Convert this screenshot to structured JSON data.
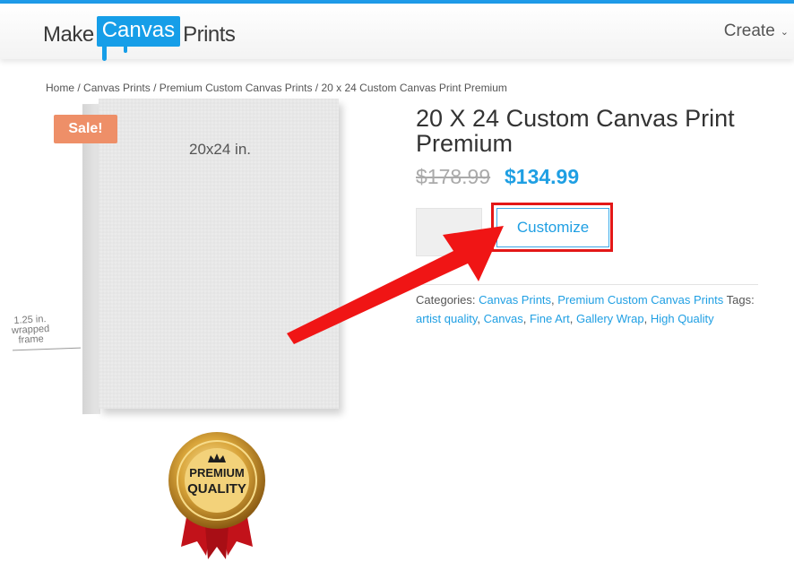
{
  "header": {
    "logo": {
      "make": "Make",
      "canvas": "Canvas",
      "prints": "Prints"
    },
    "menu_create": "Create"
  },
  "breadcrumb": [
    {
      "label": "Home"
    },
    {
      "label": "Canvas Prints"
    },
    {
      "label": "Premium Custom Canvas Prints"
    },
    {
      "label": "20 x 24 Custom Canvas Print Premium"
    }
  ],
  "breadcrumb_sep": " / ",
  "product": {
    "sale_badge": "Sale!",
    "canvas_size_label": "20x24 in.",
    "wrap_label": [
      "1.25 in.",
      "wrapped",
      "frame"
    ],
    "seal": {
      "line1": "PREMIUM",
      "line2": "QUALITY"
    },
    "title": "20 X 24 Custom Canvas Print Premium",
    "price_old": "$178.99",
    "price_new": "$134.99",
    "customize_label": "Customize",
    "categories_label": "Categories:",
    "categories": [
      "Canvas Prints",
      "Premium Custom Canvas Prints"
    ],
    "tags_label": "Tags:",
    "tags": [
      "artist quality",
      "Canvas",
      "Fine Art",
      "Gallery Wrap",
      "High Quality"
    ]
  },
  "colors": {
    "accent": "#1f9fe3",
    "sale": "#ee8f68",
    "highlight": "#e31717"
  }
}
